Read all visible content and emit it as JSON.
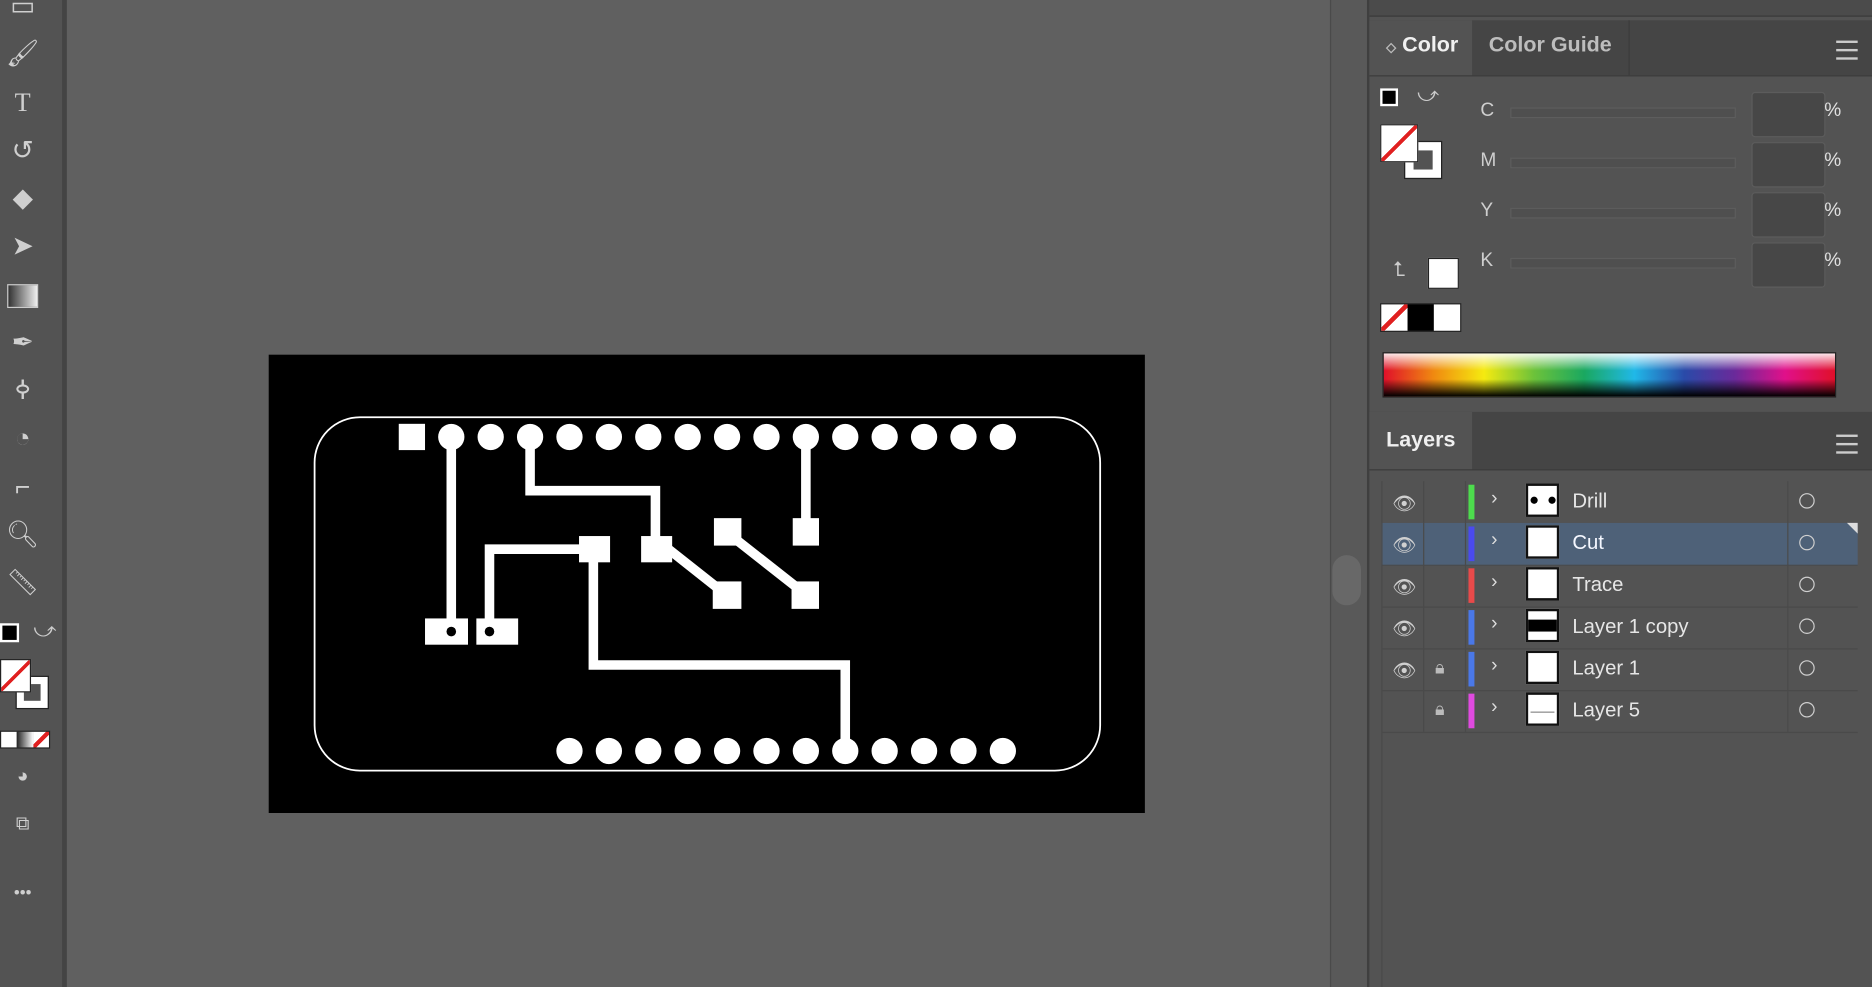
{
  "toolbar": {
    "tools": [
      "rectangle-tool",
      "paintbrush-tool",
      "type-tool",
      "rotate-tool",
      "eraser-tool",
      "lasso-select-tool",
      "gradient-tool",
      "eyedropper-tool",
      "puppet-warp-tool",
      "shape-builder-tool",
      "artboard-tool",
      "zoom-tool",
      "ruler-tool"
    ],
    "more_label": "•••"
  },
  "color_panel": {
    "tabs": [
      {
        "label": "Color",
        "active": true
      },
      {
        "label": "Color Guide",
        "active": false
      }
    ],
    "channels": [
      {
        "label": "C",
        "value": ""
      },
      {
        "label": "M",
        "value": ""
      },
      {
        "label": "Y",
        "value": ""
      },
      {
        "label": "K",
        "value": ""
      }
    ],
    "percent": "%",
    "fill": "none",
    "stroke": "#ffffff"
  },
  "layers_panel": {
    "title": "Layers",
    "layers": [
      {
        "name": "Drill",
        "visible": true,
        "locked": false,
        "color": "#4ddc4d",
        "selected": false
      },
      {
        "name": "Cut",
        "visible": true,
        "locked": false,
        "color": "#4a4af0",
        "selected": true
      },
      {
        "name": "Trace",
        "visible": true,
        "locked": false,
        "color": "#e84a4a",
        "selected": false
      },
      {
        "name": "Layer 1 copy",
        "visible": true,
        "locked": false,
        "color": "#4a78e8",
        "selected": false
      },
      {
        "name": "Layer 1",
        "visible": true,
        "locked": true,
        "color": "#4a78e8",
        "selected": false
      },
      {
        "name": "Layer 5",
        "visible": false,
        "locked": true,
        "color": "#e04ae0",
        "selected": false
      }
    ]
  }
}
